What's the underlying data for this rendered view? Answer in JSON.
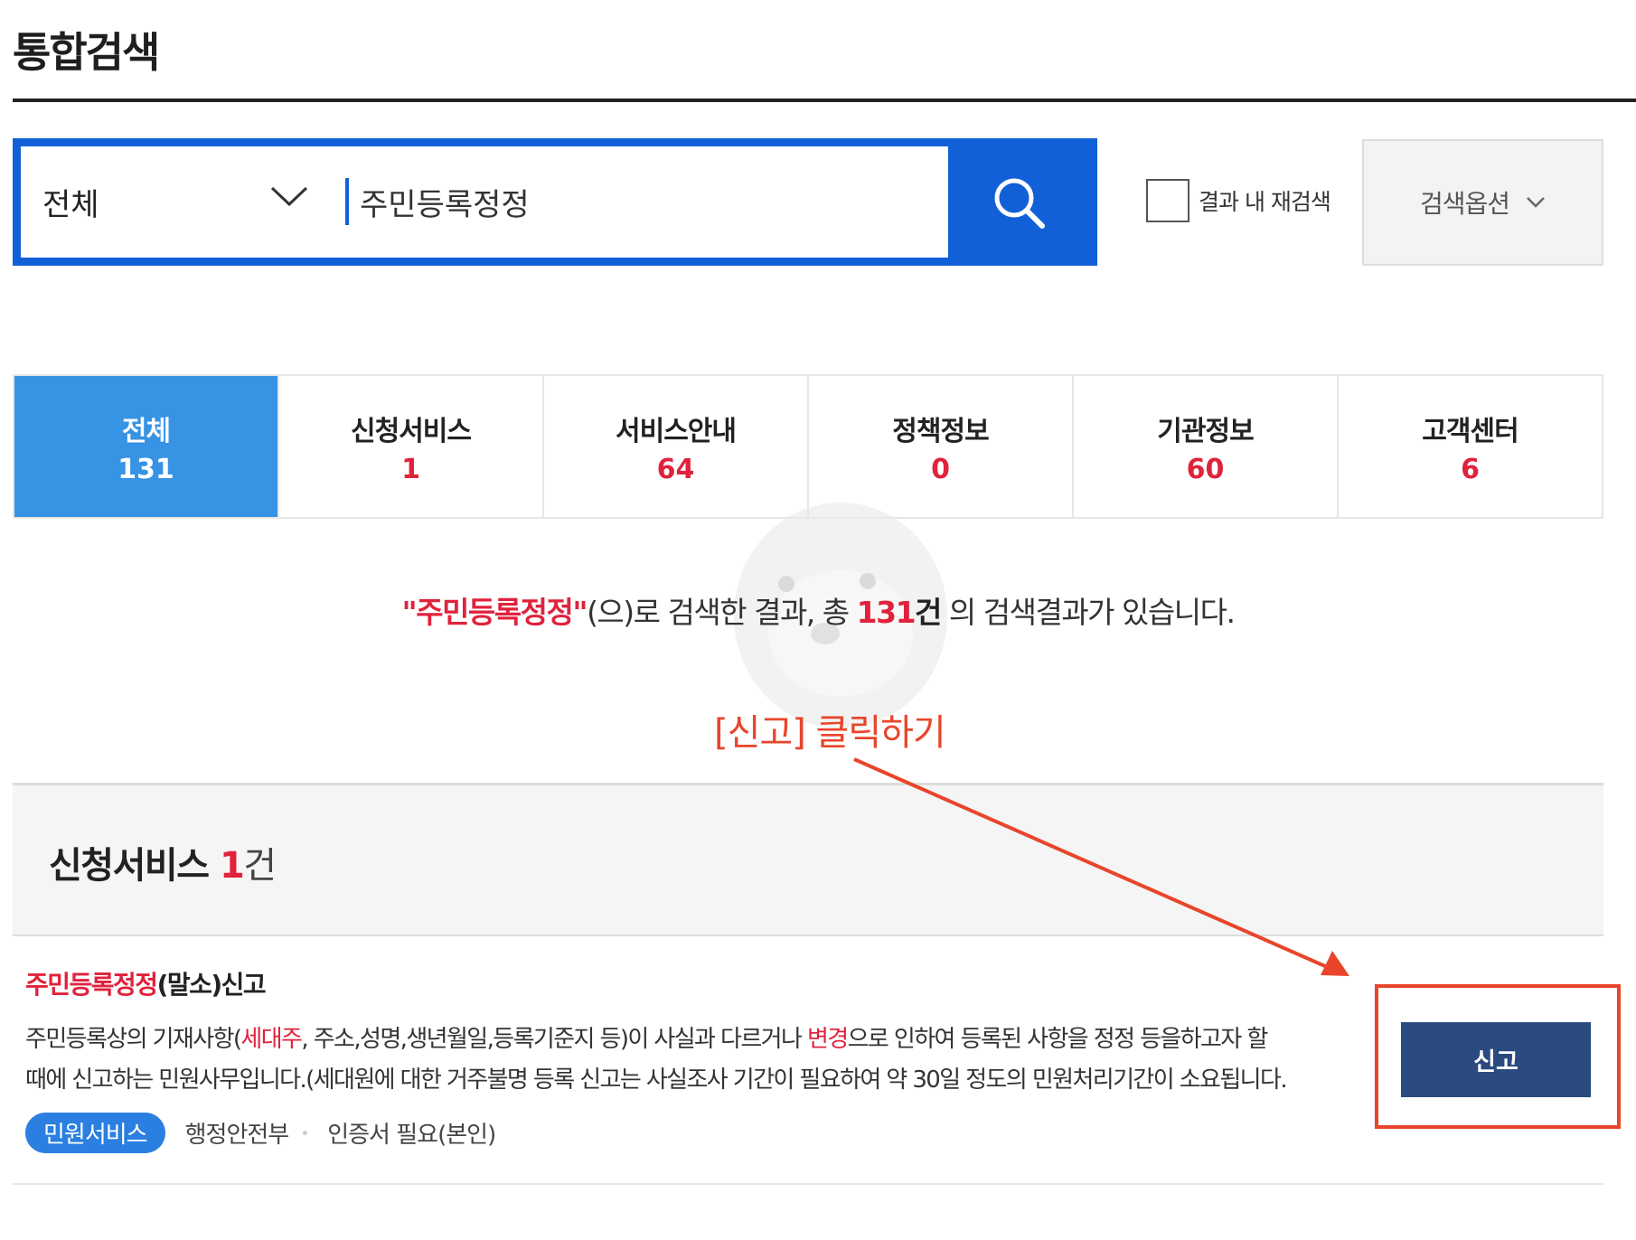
{
  "page": {
    "title": "통합검색"
  },
  "search": {
    "category": "전체",
    "query": "주민등록정정",
    "recheck_label": "결과 내 재검색",
    "options_label": "검색옵션",
    "search_icon": "search-icon"
  },
  "tabs": [
    {
      "label": "전체",
      "count": "131",
      "active": true
    },
    {
      "label": "신청서비스",
      "count": "1",
      "active": false
    },
    {
      "label": "서비스안내",
      "count": "64",
      "active": false
    },
    {
      "label": "정책정보",
      "count": "0",
      "active": false
    },
    {
      "label": "기관정보",
      "count": "60",
      "active": false
    },
    {
      "label": "고객센터",
      "count": "6",
      "active": false
    }
  ],
  "summary": {
    "keyword": "\"주민등록정정\"",
    "middle": "(으)로 검색한 결과, 총 ",
    "count": "131",
    "unit": "건",
    "tail": " 의 검색결과가 있습니다."
  },
  "annotation": {
    "label": "[신고] 클릭하기",
    "color": "#e8452b"
  },
  "section": {
    "title": "신청서비스",
    "count": "1",
    "unit": "건"
  },
  "result": {
    "title_highlight": "주민등록정정",
    "title_rest": "(말소)신고",
    "desc_1": "주민등록상의 기재사항(",
    "desc_hl_1": "세대주",
    "desc_2": ", 주소,성명,생년월일,등록기준지 등)이 사실과 다르거나 ",
    "desc_hl_2": "변경",
    "desc_3": "으로 인하여 등록된 사항을 정정 등을하고자 할",
    "desc_line2": "때에 신고하는 민원사무입니다.(세대원에 대한 거주불명 등록 신고는 사실조사 기간이 필요하여 약 30일 정도의 민원처리기간이 소요됩니다.",
    "badge": "민원서비스",
    "agency": "행정안전부",
    "cert": "인증서 필요(본인)",
    "button": "신고"
  },
  "colors": {
    "primary": "#1260d8",
    "tab_active": "#3793e4",
    "highlight": "#e0223c",
    "button": "#2a4a80"
  }
}
